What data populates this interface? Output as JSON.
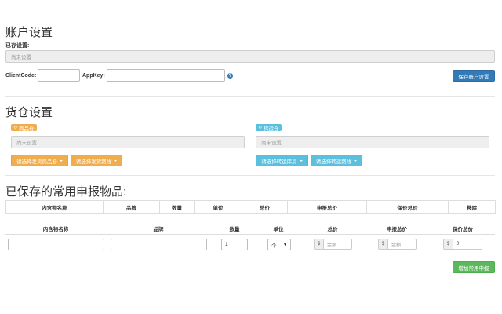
{
  "account": {
    "title": "账户设置",
    "existing_label": "已存设置:",
    "existing_value": "尚未设置",
    "client_code_label": "ClientCode:",
    "client_code_value": "",
    "app_key_label": "AppKey:",
    "app_key_value": "",
    "save_button": "保存账户设置"
  },
  "warehouse": {
    "title": "货仓设置",
    "left": {
      "badge": "商品仓",
      "value": "尚未设置",
      "btn1": "请选择发货商品仓",
      "btn2": "请选择发货路线"
    },
    "right": {
      "badge": "转运仓",
      "value": "尚未设置",
      "btn1": "请选择转运库房",
      "btn2": "请选择转运路线"
    }
  },
  "saved": {
    "title": "已保存的常用申报物品:",
    "headers": [
      "内含物名称",
      "品牌",
      "数量",
      "单位",
      "总价",
      "申报总价",
      "保价总价",
      "移除"
    ]
  },
  "new_item": {
    "headers": [
      "内含物名称",
      "品牌",
      "数量",
      "单位",
      "总价",
      "申报总价",
      "保价总价"
    ],
    "name_value": "",
    "brand_value": "",
    "quantity_value": "1",
    "unit_value": "个",
    "currency_symbol": "$",
    "total_placeholder": "金额",
    "declared_placeholder": "金额",
    "insured_value": "0",
    "add_button": "增加常用申报"
  },
  "colors": {
    "primary": "#337ab7",
    "warning": "#f0ad4e",
    "info": "#5bc0de",
    "success": "#5cb85c"
  }
}
